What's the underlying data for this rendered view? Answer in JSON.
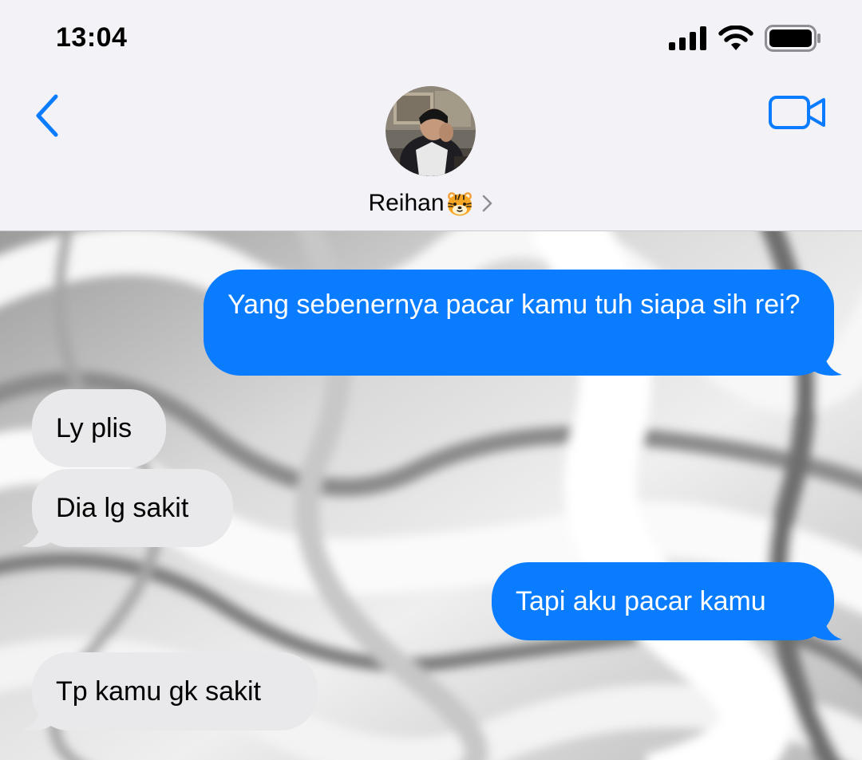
{
  "status_bar": {
    "time": "13:04",
    "icons": [
      "cellular-signal-icon",
      "wifi-icon",
      "battery-icon"
    ]
  },
  "header": {
    "back_icon": "chevron-left-icon",
    "contact_name": "Reihan",
    "contact_emoji": "tiger-face-emoji",
    "chevron_icon": "chevron-right-icon",
    "video_icon": "video-camera-icon"
  },
  "messages": [
    {
      "direction": "outgoing",
      "text": "Yang sebenernya pacar kamu tuh siapa sih rei?"
    },
    {
      "direction": "incoming",
      "text": "Ly plis"
    },
    {
      "direction": "incoming",
      "text": "Dia lg sakit"
    },
    {
      "direction": "outgoing",
      "text": "Tapi aku pacar kamu"
    },
    {
      "direction": "incoming",
      "text": "Tp kamu gk sakit"
    }
  ],
  "colors": {
    "accent": "#0a7cff",
    "outgoing_bubble": "#0a7cff",
    "incoming_bubble": "#e9e9eb",
    "header_bg": "#f2f2f7"
  }
}
